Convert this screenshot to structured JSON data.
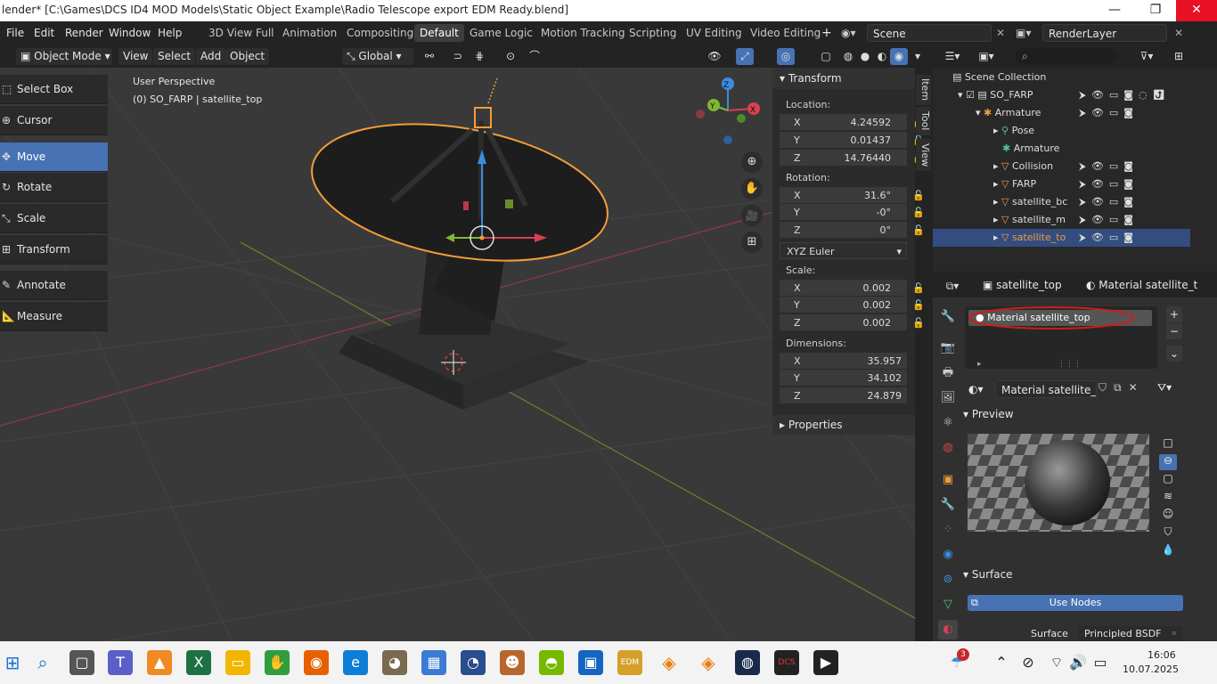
{
  "window": {
    "title": "lender* [C:\\Games\\DCS ID4 MOD Models\\Static Object Example\\Radio Telescope export EDM Ready.blend]",
    "minimize": "—",
    "maximize": "❐",
    "close": "✕"
  },
  "menu": {
    "items": [
      "File",
      "Edit",
      "Render",
      "Window",
      "Help"
    ],
    "tabs": [
      "3D View Full",
      "Animation",
      "Compositing",
      "Default",
      "Game Logic",
      "Motion Tracking",
      "Scripting",
      "UV Editing",
      "Video Editing"
    ],
    "active_tab": "Default",
    "add_tab": "+",
    "scene": "Scene",
    "render_layer": "RenderLayer"
  },
  "header3d": {
    "mode": "Object Mode",
    "menus": [
      "View",
      "Select",
      "Add",
      "Object"
    ],
    "orientation": "Global"
  },
  "viewport": {
    "perspective": "User Perspective",
    "object_info": "(0) SO_FARP | satellite_top",
    "gizmo": {
      "z": "Z",
      "y": "Y",
      "x": "X"
    }
  },
  "tools": [
    "Select Box",
    "Cursor",
    "Move",
    "Rotate",
    "Scale",
    "Transform",
    "Annotate",
    "Measure"
  ],
  "active_tool": "Move",
  "npanel": {
    "header": "Transform",
    "location_label": "Location:",
    "location": [
      {
        "axis": "X",
        "value": "4.24592"
      },
      {
        "axis": "Y",
        "value": "0.01437"
      },
      {
        "axis": "Z",
        "value": "14.76440"
      }
    ],
    "rotation_label": "Rotation:",
    "rotation": [
      {
        "axis": "X",
        "value": "31.6°"
      },
      {
        "axis": "Y",
        "value": "-0°"
      },
      {
        "axis": "Z",
        "value": "0°"
      }
    ],
    "rotation_mode": "XYZ Euler",
    "scale_label": "Scale:",
    "scale": [
      {
        "axis": "X",
        "value": "0.002"
      },
      {
        "axis": "Y",
        "value": "0.002"
      },
      {
        "axis": "Z",
        "value": "0.002"
      }
    ],
    "dimensions_label": "Dimensions:",
    "dimensions": [
      {
        "axis": "X",
        "value": "35.957"
      },
      {
        "axis": "Y",
        "value": "34.102"
      },
      {
        "axis": "Z",
        "value": "24.879"
      }
    ],
    "properties": "Properties",
    "tabs": [
      "Item",
      "Tool",
      "View"
    ]
  },
  "outliner": {
    "root": "Scene Collection",
    "rows": [
      {
        "name": "SO_FARP",
        "indent": 1
      },
      {
        "name": "Armature",
        "indent": 2
      },
      {
        "name": "Pose",
        "indent": 3
      },
      {
        "name": "Armature",
        "indent": 3
      },
      {
        "name": "Collision",
        "indent": 3
      },
      {
        "name": "FARP",
        "indent": 3
      },
      {
        "name": "satellite_bc",
        "indent": 3
      },
      {
        "name": "satellite_m",
        "indent": 3
      },
      {
        "name": "satellite_to",
        "indent": 3
      }
    ]
  },
  "properties": {
    "object": "satellite_top",
    "material_crumb": "Material satellite_t",
    "slot": "Material satellite_top",
    "material_field": "Material satellite_t..",
    "preview": "Preview",
    "surface": "Surface",
    "use_nodes": "Use Nodes",
    "surface_label": "Surface",
    "surface_value": "Principled BSDF"
  },
  "taskbar": {
    "time": "16:06",
    "date": "10.07.2025",
    "badge": "3"
  },
  "colors": {
    "selection_outline": "#f39c3a",
    "active_tool": "#4772b3",
    "x_axis": "#d9404f",
    "y_axis": "#7fb832",
    "z_axis": "#3a8cde"
  }
}
